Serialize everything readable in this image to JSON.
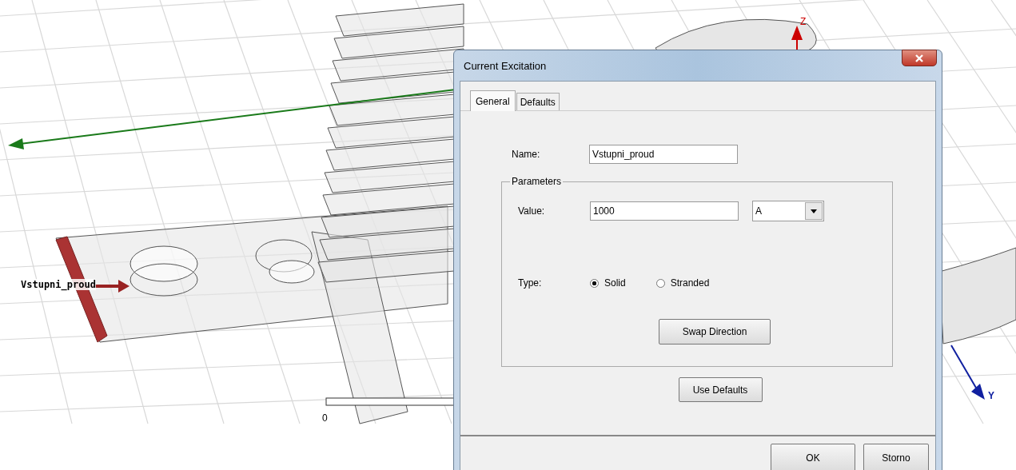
{
  "viewport": {
    "object_label": "Vstupni_proud",
    "scale_label": "0",
    "z_axis_label": "Z",
    "y_axis_label": "Y"
  },
  "dialog": {
    "title": "Current Excitation",
    "tabs": [
      {
        "label": "General",
        "selected": true
      },
      {
        "label": "Defaults",
        "selected": false
      }
    ],
    "name": {
      "label": "Name:",
      "value": "Vstupni_proud"
    },
    "parameters": {
      "title": "Parameters",
      "value": {
        "label": "Value:",
        "value": "1000",
        "unit": "A"
      },
      "type": {
        "label": "Type:",
        "options": [
          {
            "label": "Solid",
            "selected": true
          },
          {
            "label": "Stranded",
            "selected": false
          }
        ]
      },
      "swap_button": "Swap Direction"
    },
    "defaults_button": "Use Defaults",
    "buttons": [
      "OK",
      "Storno"
    ]
  }
}
